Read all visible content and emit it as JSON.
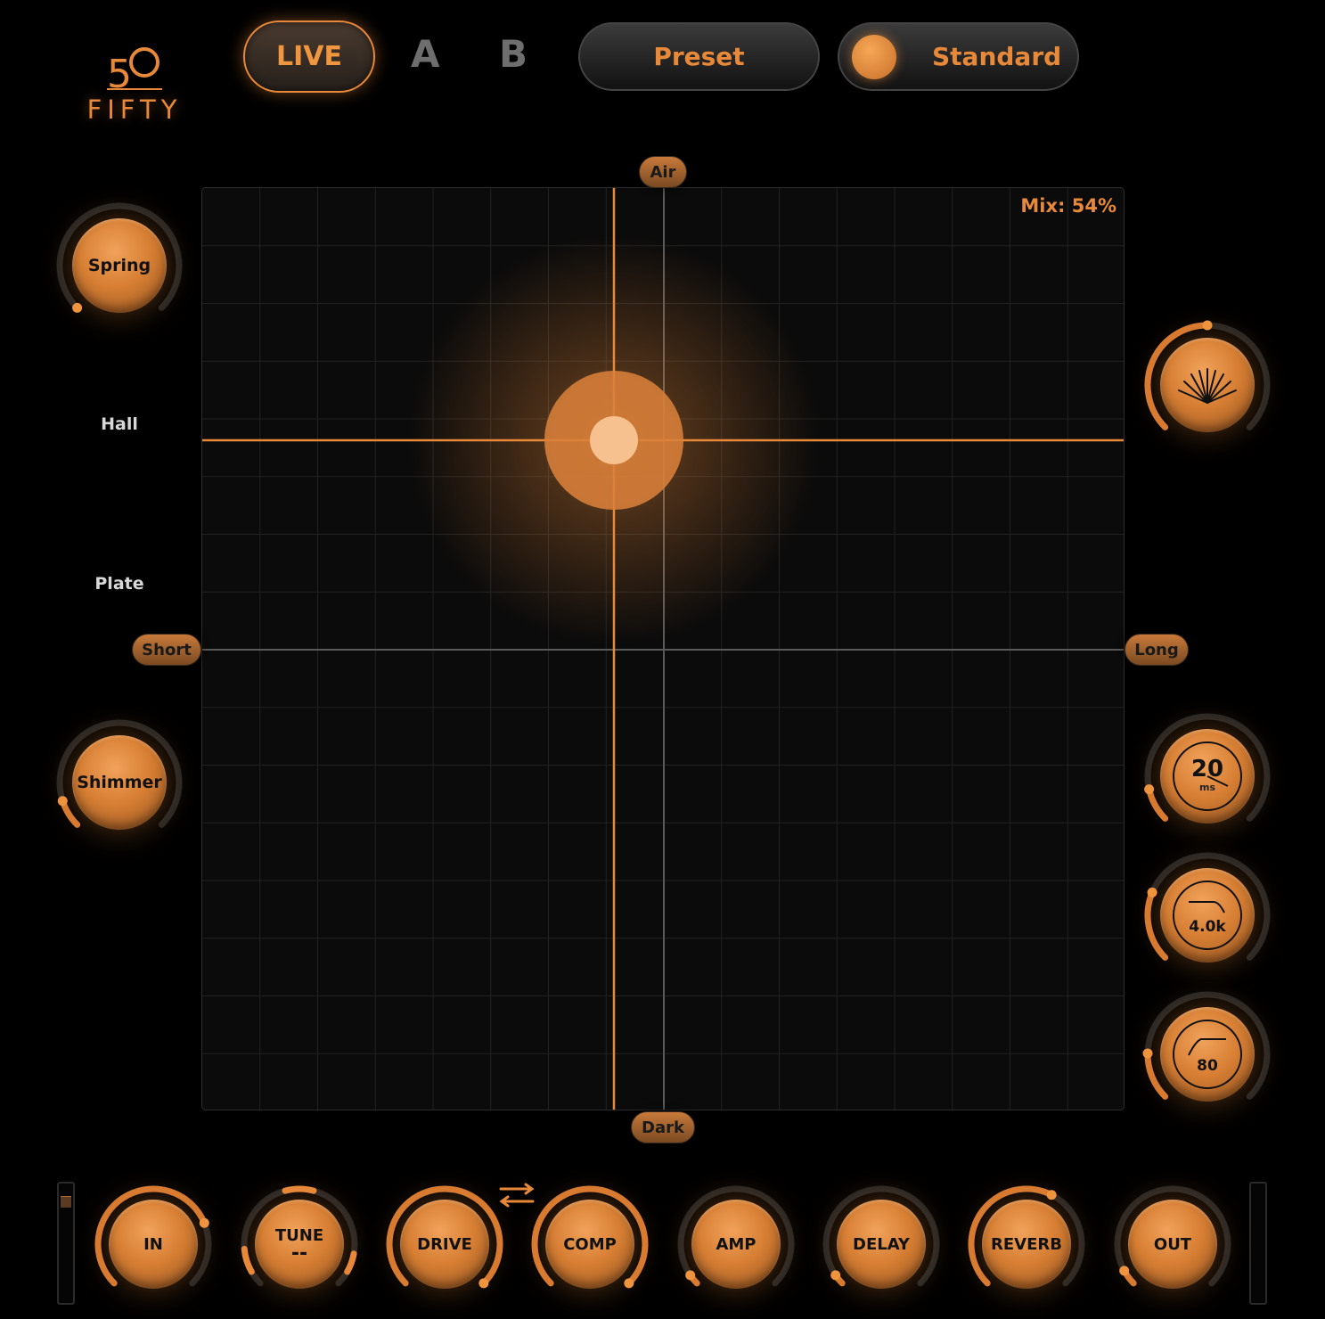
{
  "logo": {
    "numeral": "50",
    "wordmark": "FIFTY"
  },
  "header": {
    "modes": {
      "live": "LIVE",
      "a": "A",
      "b": "B"
    },
    "preset_label": "Preset",
    "standard_label": "Standard"
  },
  "xy_pad": {
    "mix_label": "Mix: 54%",
    "axes": {
      "top": "Air",
      "bottom": "Dark",
      "left": "Short",
      "right": "Long"
    }
  },
  "left_panel": {
    "reverb_types": [
      "Spring",
      "Hall",
      "Plate",
      "Shimmer"
    ],
    "spring_knob": {
      "label": "Spring",
      "value": 0.0
    },
    "shimmer_knob": {
      "label": "Shimmer",
      "value": 0.1
    }
  },
  "right_panel": {
    "diffusion_knob": {
      "icon": "diffusion-fan-icon",
      "value": 0.5
    },
    "predelay_knob": {
      "value": "20",
      "unit": "ms",
      "level": 0.12
    },
    "lowpass_knob": {
      "value": "4.0k",
      "icon": "lowpass-filter-icon",
      "level": 0.25
    },
    "highpass_knob": {
      "value": "80",
      "icon": "highpass-filter-icon",
      "level": 0.17
    }
  },
  "signal_chain": [
    {
      "label": "IN",
      "level": 0.75
    },
    {
      "label": "TUNE",
      "sub": "--",
      "level": 0.0
    },
    {
      "label": "DRIVE",
      "level": 1.0
    },
    {
      "label": "COMP",
      "level": 1.0
    },
    {
      "label": "AMP",
      "level": 0.04
    },
    {
      "label": "DELAY",
      "level": 0.04
    },
    {
      "label": "REVERB",
      "level": 0.6
    },
    {
      "label": "OUT",
      "level": 0.06
    }
  ],
  "colors": {
    "accent": "#e8893a",
    "background": "#000000",
    "pad": "#0b0b0b",
    "grid": "#262626"
  }
}
